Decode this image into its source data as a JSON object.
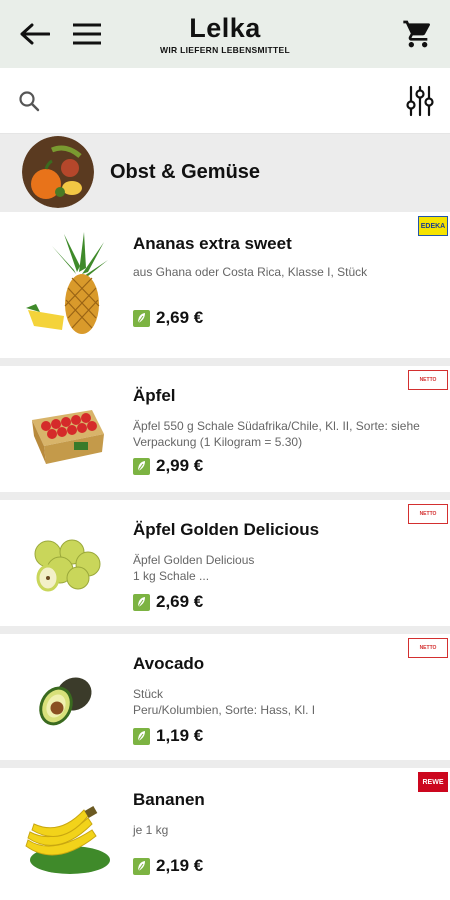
{
  "app": {
    "title": "Lelka",
    "subtitle": "WIR LIEFERN LEBENSMITTEL"
  },
  "search": {
    "placeholder": ""
  },
  "category": {
    "title": "Obst & Gemüse"
  },
  "products": [
    {
      "name": "Ananas extra sweet",
      "desc": "aus Ghana oder Costa Rica, Klasse I, Stück",
      "price": "2,69 €",
      "store": "EDEKA"
    },
    {
      "name": "Äpfel",
      "desc": "Äpfel 550 g Schale Südafrika/Chile, Kl. II, Sorte: siehe Verpackung (1 Kilogram = 5.30)",
      "price": "2,99 €",
      "store": "NETTO"
    },
    {
      "name": "Äpfel Golden Delicious",
      "desc": "Äpfel Golden Delicious\n1 kg Schale ...",
      "price": "2,69 €",
      "store": "NETTO"
    },
    {
      "name": "Avocado",
      "desc": "Stück\nPeru/Kolumbien, Sorte: Hass, Kl. I",
      "price": "1,19 €",
      "store": "NETTO"
    },
    {
      "name": "Bananen",
      "desc": "je 1 kg",
      "price": "2,19 €",
      "store": "REWE"
    }
  ]
}
